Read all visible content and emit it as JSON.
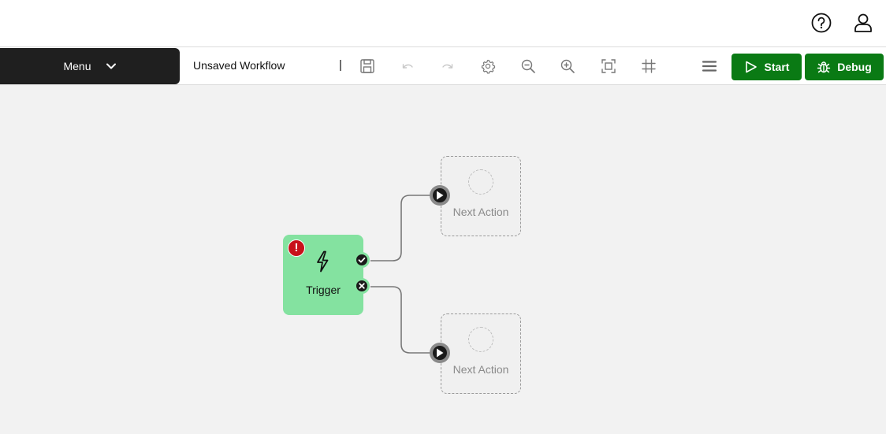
{
  "header": {
    "help_icon": "question-circle-icon",
    "user_icon": "user-icon"
  },
  "toolbar": {
    "menu_label": "Menu",
    "workflow_name": "Unsaved Workflow",
    "cursor_text": "|",
    "icons": [
      "save-icon",
      "undo-icon",
      "redo-icon",
      "settings-icon",
      "zoom-out-icon",
      "zoom-in-icon",
      "fit-view-icon",
      "grid-icon",
      "hamburger-menu-icon"
    ],
    "start_label": "Start",
    "debug_label": "Debug",
    "accent_color": "#0a7a14"
  },
  "canvas": {
    "trigger": {
      "label": "Trigger",
      "color": "#84e2a0",
      "error_badge": "!",
      "error_color": "#c8101a"
    },
    "actions": [
      {
        "label": "Next Action"
      },
      {
        "label": "Next Action"
      }
    ]
  }
}
